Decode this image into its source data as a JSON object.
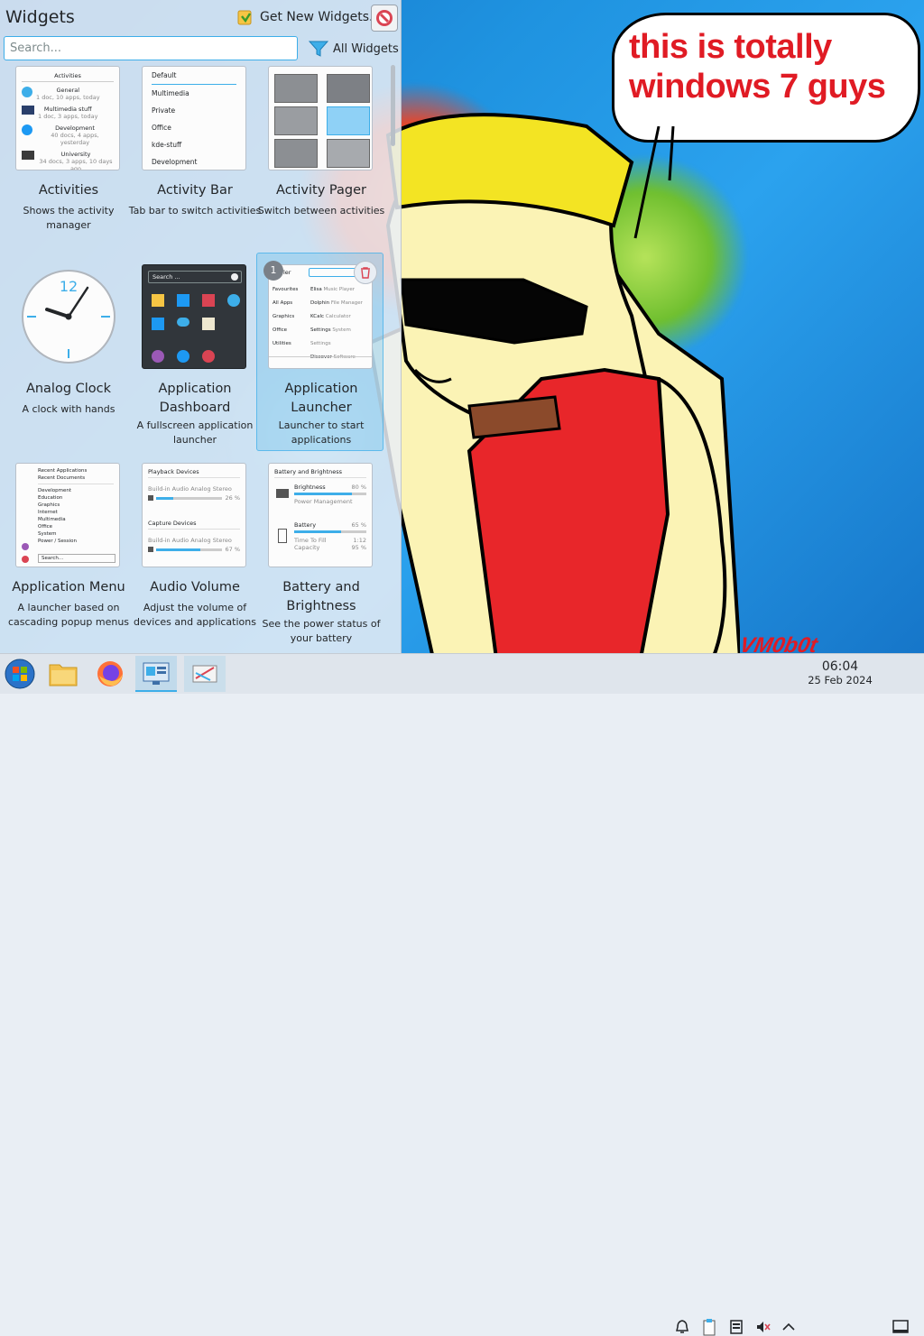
{
  "panel": {
    "title": "Widgets",
    "get_new_label": "Get New Widgets...",
    "search_placeholder": "Search...",
    "filter_label": "All Widgets"
  },
  "widgets": [
    {
      "name": "Activities",
      "desc": "Shows the activity manager"
    },
    {
      "name": "Activity Bar",
      "desc": "Tab bar to switch activities"
    },
    {
      "name": "Activity Pager",
      "desc": "Switch between activities"
    },
    {
      "name": "Analog Clock",
      "desc": "A clock with hands"
    },
    {
      "name": "Application Dashboard",
      "desc": "A fullscreen application launcher"
    },
    {
      "name": "Application Launcher",
      "desc": "Launcher to start applications"
    },
    {
      "name": "Application Menu",
      "desc": "A launcher based on cascading popup menus"
    },
    {
      "name": "Audio Volume",
      "desc": "Adjust the volume of devices and applications"
    },
    {
      "name": "Battery and Brightness",
      "desc": "See the power status of your battery"
    }
  ],
  "thumbs": {
    "activities": {
      "header": "Activities",
      "items": [
        {
          "title": "General",
          "sub": "1 doc, 10 apps, today"
        },
        {
          "title": "Multimedia stuff",
          "sub": "1 doc, 3 apps, today"
        },
        {
          "title": "Development",
          "sub": "40 docs, 4 apps, yesterday"
        },
        {
          "title": "University",
          "sub": "34 docs, 3 apps, 10 days ago"
        }
      ]
    },
    "activity_bar": [
      "Default",
      "Multimedia",
      "Private",
      "Office",
      "kde-stuff",
      "Development"
    ],
    "dashboard_search": "Search ...",
    "launcher_badge": "1",
    "launcher": {
      "search_frag": "ler",
      "left": [
        "Favourites",
        "All Apps",
        "Graphics",
        "Office",
        "Utilities"
      ],
      "right": [
        {
          "title": "Elisa",
          "sub": "Music Player"
        },
        {
          "title": "Dolphin",
          "sub": "File Manager"
        },
        {
          "title": "KCalc",
          "sub": "Calculator"
        },
        {
          "title": "Settings",
          "sub": "System Settings"
        },
        {
          "title": "Discover",
          "sub": "Software Center"
        }
      ]
    },
    "app_menu": {
      "top": [
        "Recent Applications",
        "Recent Documents"
      ],
      "items": [
        "Development",
        "Education",
        "Graphics",
        "Internet",
        "Multimedia",
        "Office",
        "System",
        "Power / Session"
      ],
      "search": "Search..."
    },
    "audio": {
      "playback": "Playback Devices",
      "playback_dev": "Build-in Audio Analog Stereo",
      "playback_pct": "26 %",
      "playback_level": 0.26,
      "capture": "Capture Devices",
      "capture_dev": "Build-in Audio Analog Stereo",
      "capture_pct": "67 %",
      "capture_level": 0.67
    },
    "battery": {
      "header": "Battery and Brightness",
      "brightness": "Brightness",
      "brightness_pct": "80 %",
      "brightness_level": 0.8,
      "power_mgmt": "Power Management",
      "battery": "Battery",
      "battery_pct": "65 %",
      "battery_level": 0.65,
      "time_to_fill": "Time To Fill",
      "time_val": "1:12",
      "capacity": "Capacity",
      "capacity_val": "95 %"
    }
  },
  "bubble_text": "this is totally windows 7 guys",
  "signature": "VM0b0t",
  "clock": {
    "time": "06:04",
    "date": "25 Feb 2024"
  },
  "colors": {
    "accent": "#3daee9",
    "bubble_text": "#e01b24"
  }
}
